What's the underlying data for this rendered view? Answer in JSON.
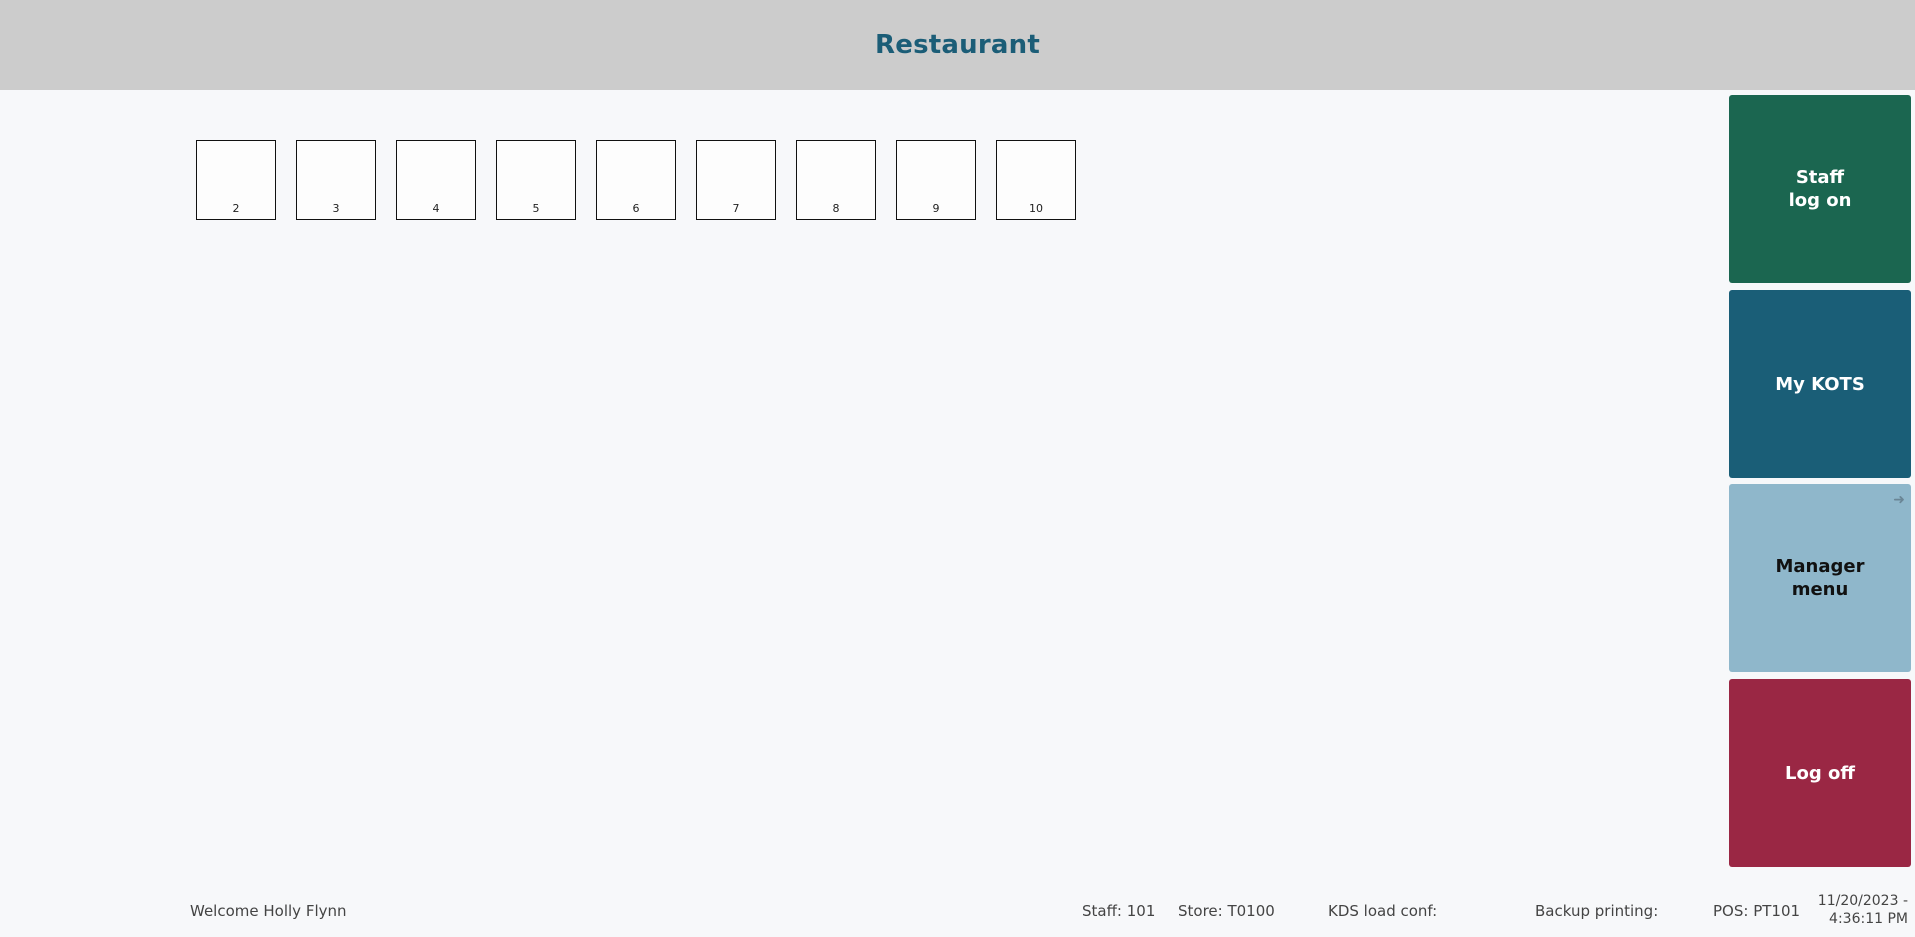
{
  "header": {
    "title": "Restaurant"
  },
  "tables": [
    "2",
    "3",
    "4",
    "5",
    "6",
    "7",
    "8",
    "9",
    "10"
  ],
  "side_buttons": {
    "staff_log_on": "Staff\nlog on",
    "my_kots": "My KOTS",
    "manager_menu": "Manager\nmenu",
    "log_off": "Log off"
  },
  "footer": {
    "welcome": "Welcome Holly Flynn",
    "staff": "Staff: 101",
    "store": "Store: T0100",
    "kds": "KDS load conf:",
    "backup": "Backup printing:",
    "pos": "POS: PT101",
    "date": "11/20/2023 -",
    "time": "4:36:11 PM"
  },
  "colors": {
    "header_bg": "#cccccc",
    "title": "#1b5d77",
    "staff_log_on": "#1b6650",
    "my_kots": "#1a5e77",
    "manager_menu": "#8fb7cb",
    "log_off": "#9a2744"
  },
  "icons": {
    "manager_menu_arrow": "arrow-right-icon"
  }
}
